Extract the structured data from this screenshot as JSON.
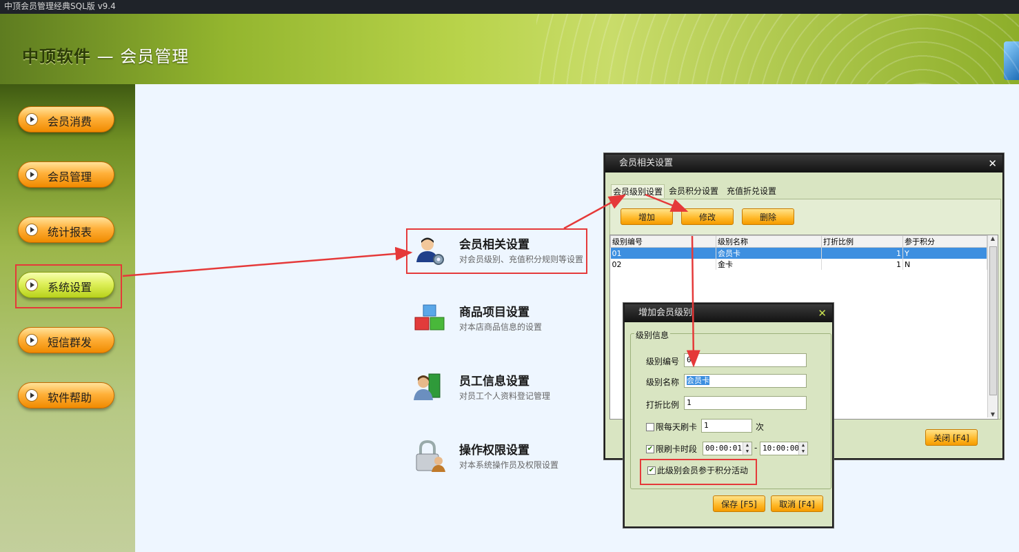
{
  "window": {
    "title": "中顶会员管理经典SQL版 v9.4"
  },
  "header": {
    "brand": "中顶软件",
    "separator": " — ",
    "subtitle": "会员管理"
  },
  "sidebar": {
    "items": [
      {
        "label": "会员消费"
      },
      {
        "label": "会员管理"
      },
      {
        "label": "统计报表"
      },
      {
        "label": "系统设置"
      },
      {
        "label": "短信群发"
      },
      {
        "label": "软件帮助"
      }
    ]
  },
  "settings": [
    {
      "title": "会员相关设置",
      "desc": "对会员级别、充值积分规则等设置",
      "icon": "member-settings-icon"
    },
    {
      "title": "商品项目设置",
      "desc": "对本店商品信息的设置",
      "icon": "product-cubes-icon"
    },
    {
      "title": "员工信息设置",
      "desc": "对员工个人资料登记管理",
      "icon": "employee-book-icon"
    },
    {
      "title": "操作权限设置",
      "desc": "对本系统操作员及权限设置",
      "icon": "lock-user-icon"
    }
  ],
  "member_dialog": {
    "title": "会员相关设置",
    "tabs": [
      "会员级别设置",
      "会员积分设置",
      "充值折兑设置"
    ],
    "buttons": {
      "add": "增加",
      "edit": "修改",
      "delete": "删除",
      "close": "关闭 [F4]"
    },
    "columns": [
      "级别编号",
      "级别名称",
      "打折比例",
      "参于积分"
    ],
    "rows": [
      {
        "code": "01",
        "name": "会员卡",
        "ratio": "1",
        "points": "Y"
      },
      {
        "code": "02",
        "name": "金卡",
        "ratio": "1",
        "points": "N"
      }
    ]
  },
  "add_dialog": {
    "title": "增加会员级别",
    "group": "级别信息",
    "fields": {
      "code_label": "级别编号",
      "code_value": "0",
      "name_label": "级别名称",
      "name_value": "会员卡",
      "ratio_label": "打折比例",
      "ratio_value": "1",
      "daily_label": "限每天刷卡",
      "daily_value": "1",
      "daily_unit": "次",
      "period_label": "限刷卡时段",
      "period_start": "00:00:01",
      "period_dash": "-",
      "period_end": "10:00:00",
      "points_label": "此级别会员参于积分活动"
    },
    "checks": {
      "daily": false,
      "period": true,
      "points": true
    },
    "buttons": {
      "save": "保存 [F5]",
      "cancel": "取消 [F4]"
    }
  },
  "colors": {
    "accent": "#f59b00",
    "highlight": "#e53939",
    "selection": "#3d8fe0"
  }
}
